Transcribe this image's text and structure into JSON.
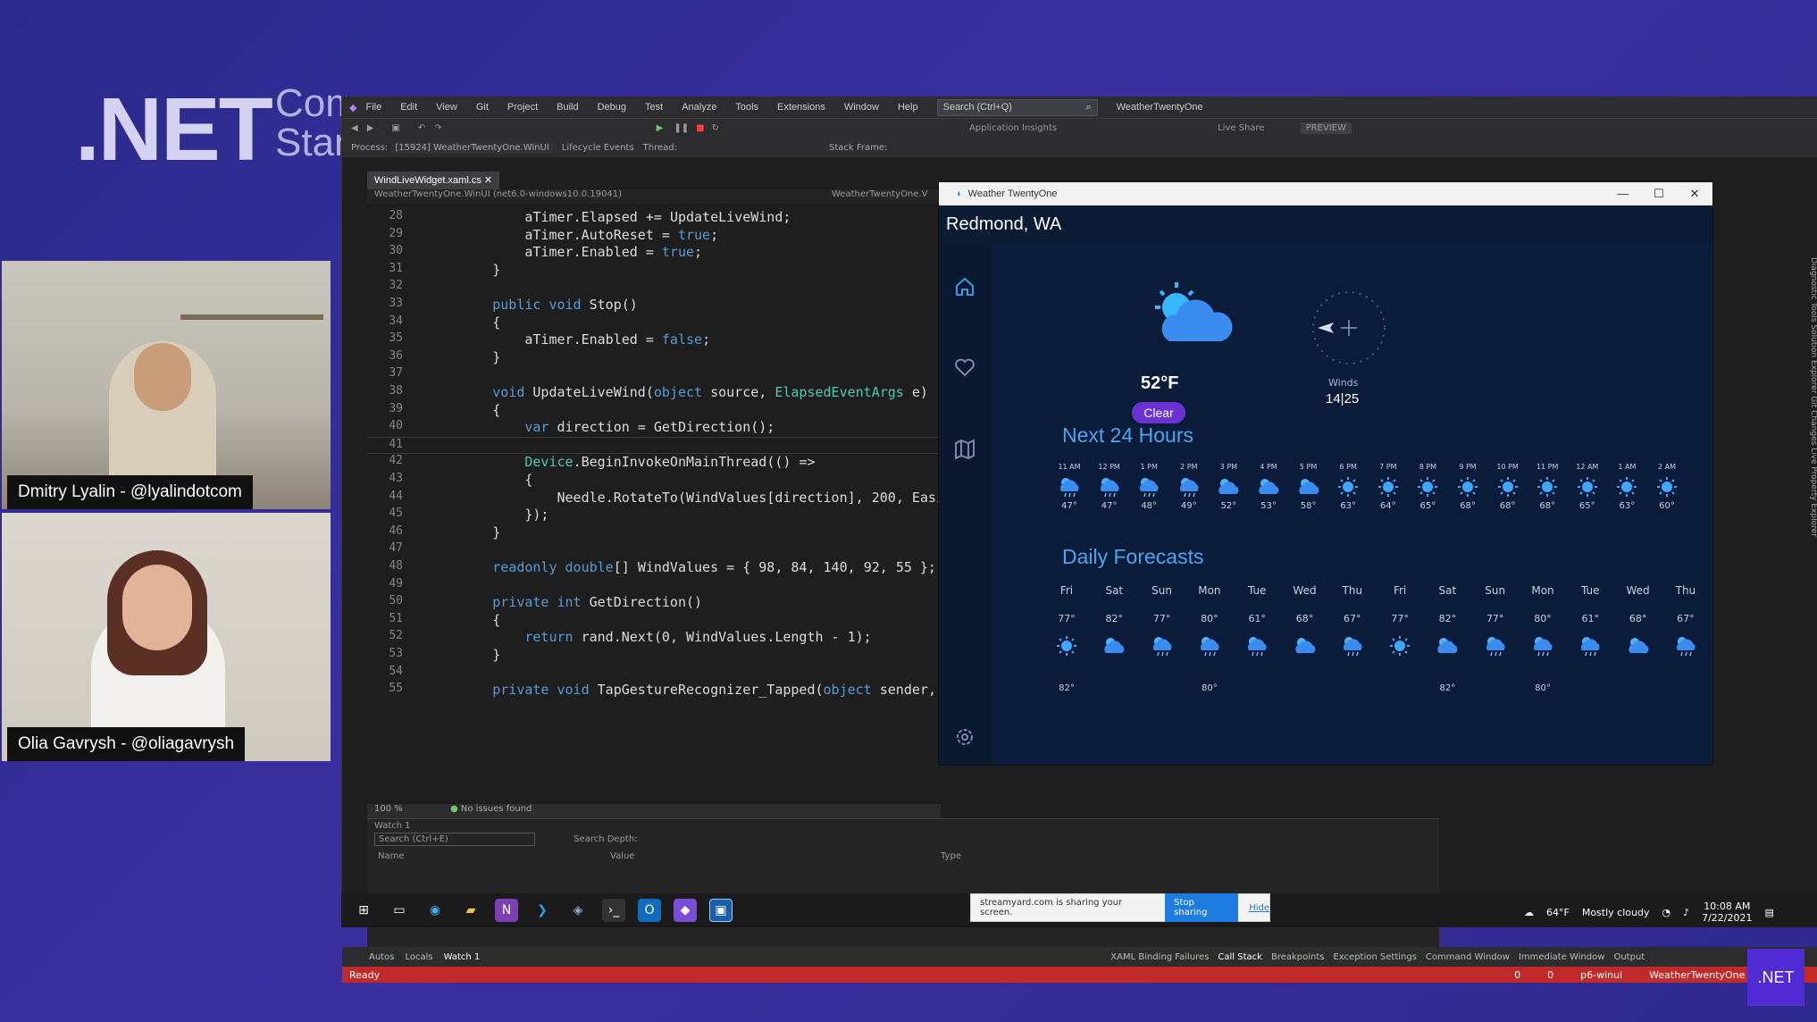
{
  "background": {
    "brand": ".NET",
    "brand_sub_1": "Com",
    "brand_sub_2": "Stan"
  },
  "participants": [
    {
      "name": "Dmitry Lyalin - @lyalindotcom"
    },
    {
      "name": "Olia Gavrysh - @oliagavrysh"
    }
  ],
  "vs": {
    "menu": [
      "File",
      "Edit",
      "View",
      "Git",
      "Project",
      "Build",
      "Debug",
      "Test",
      "Analyze",
      "Tools",
      "Extensions",
      "Window",
      "Help"
    ],
    "search_placeholder": "Search (Ctrl+Q)",
    "solution_title": "WeatherTwentyOne",
    "toolbar_right": [
      "Application Insights",
      "Live Share",
      "PREVIEW"
    ],
    "process_label": "Process:",
    "process_value": "[15924] WeatherTwentyOne.WinUI",
    "lifecycle_label": "Lifecycle Events",
    "thread_label": "Thread:",
    "stack_frame_label": "Stack Frame:",
    "file_tab": "WindLiveWidget.xaml.cs",
    "nav_project": "WeatherTwentyOne.WinUI (net6.0-windows10.0.19041)",
    "nav_class": "WeatherTwentyOne.V",
    "code_lines": [
      {
        "n": "28",
        "code": "            aTimer.Elapsed += UpdateLiveWind;"
      },
      {
        "n": "29",
        "code": "            aTimer.AutoReset = true;"
      },
      {
        "n": "30",
        "code": "            aTimer.Enabled = true;"
      },
      {
        "n": "31",
        "code": "        }"
      },
      {
        "n": "32",
        "code": ""
      },
      {
        "n": "33",
        "code": "        public void Stop()"
      },
      {
        "n": "34",
        "code": "        {"
      },
      {
        "n": "35",
        "code": "            aTimer.Enabled = false;"
      },
      {
        "n": "36",
        "code": "        }"
      },
      {
        "n": "37",
        "code": ""
      },
      {
        "n": "38",
        "code": "        void UpdateLiveWind(object source, ElapsedEventArgs e)"
      },
      {
        "n": "39",
        "code": "        {"
      },
      {
        "n": "40",
        "code": "            var direction = GetDirection();"
      },
      {
        "n": "41",
        "code": ""
      },
      {
        "n": "42",
        "code": "            Device.BeginInvokeOnMainThread(() =>"
      },
      {
        "n": "43",
        "code": "            {"
      },
      {
        "n": "44",
        "code": "                Needle.RotateTo(WindValues[direction], 200, Easi"
      },
      {
        "n": "45",
        "code": "            });"
      },
      {
        "n": "46",
        "code": "        }"
      },
      {
        "n": "47",
        "code": ""
      },
      {
        "n": "48",
        "code": "        readonly double[] WindValues = { 98, 84, 140, 92, 55 };"
      },
      {
        "n": "49",
        "code": ""
      },
      {
        "n": "50",
        "code": "        private int GetDirection()"
      },
      {
        "n": "51",
        "code": "        {"
      },
      {
        "n": "52",
        "code": "            return rand.Next(0, WindValues.Length - 1);"
      },
      {
        "n": "53",
        "code": "        }"
      },
      {
        "n": "54",
        "code": ""
      },
      {
        "n": "55",
        "code": "        private void TapGestureRecognizer_Tapped(object sender,"
      }
    ],
    "zoom": "100 %",
    "issues": "No issues found",
    "watch_title": "Watch 1",
    "watch_search": "Search (Ctrl+E)",
    "watch_depth": "Search Depth:",
    "watch_cols": [
      "Name",
      "Value",
      "Type"
    ],
    "debug_tabs_left": [
      "Autos",
      "Locals",
      "Watch 1"
    ],
    "debug_tabs_right": [
      "XAML Binding Failures",
      "Call Stack",
      "Breakpoints",
      "Exception Settings",
      "Command Window",
      "Immediate Window",
      "Output"
    ],
    "status": "Ready",
    "status_right": [
      "0",
      "0",
      "p6-winui",
      "WeatherTwentyOne"
    ],
    "right_rail": "Diagnostic Tools   Solution Explorer   Git Changes   Live Property Explorer"
  },
  "app": {
    "window_title": "Weather TwentyOne",
    "location": "Redmond, WA",
    "current_temp": "52°F",
    "condition_button": "Clear",
    "winds_label": "Winds",
    "winds_value": "14|25",
    "next24_title": "Next 24 Hours",
    "hours": [
      {
        "t": "11 AM",
        "v": "47°",
        "icon": "cloud-rain"
      },
      {
        "t": "12 PM",
        "v": "47°",
        "icon": "cloud-rain"
      },
      {
        "t": "1 PM",
        "v": "48°",
        "icon": "cloud-rain"
      },
      {
        "t": "2 PM",
        "v": "49°",
        "icon": "cloud-rain"
      },
      {
        "t": "3 PM",
        "v": "52°",
        "icon": "cloud"
      },
      {
        "t": "4 PM",
        "v": "53°",
        "icon": "cloud"
      },
      {
        "t": "5 PM",
        "v": "58°",
        "icon": "cloud"
      },
      {
        "t": "6 PM",
        "v": "63°",
        "icon": "sun"
      },
      {
        "t": "7 PM",
        "v": "64°",
        "icon": "sun"
      },
      {
        "t": "8 PM",
        "v": "65°",
        "icon": "sun"
      },
      {
        "t": "9 PM",
        "v": "68°",
        "icon": "sun"
      },
      {
        "t": "10 PM",
        "v": "68°",
        "icon": "sun"
      },
      {
        "t": "11 PM",
        "v": "68°",
        "icon": "sun"
      },
      {
        "t": "12 AM",
        "v": "65°",
        "icon": "sun"
      },
      {
        "t": "1 AM",
        "v": "63°",
        "icon": "sun"
      },
      {
        "t": "2 AM",
        "v": "60°",
        "icon": "sun"
      }
    ],
    "daily_title": "Daily Forecasts",
    "days": [
      {
        "d": "Fri",
        "v": "77°",
        "icon": "sun",
        "lo": "82°"
      },
      {
        "d": "Sat",
        "v": "82°",
        "icon": "cloud",
        "lo": ""
      },
      {
        "d": "Sun",
        "v": "77°",
        "icon": "cloud-rain",
        "lo": ""
      },
      {
        "d": "Mon",
        "v": "80°",
        "icon": "cloud-rain",
        "lo": "80°"
      },
      {
        "d": "Tue",
        "v": "61°",
        "icon": "cloud-rain",
        "lo": ""
      },
      {
        "d": "Wed",
        "v": "68°",
        "icon": "cloud",
        "lo": ""
      },
      {
        "d": "Thu",
        "v": "67°",
        "icon": "cloud-rain",
        "lo": ""
      },
      {
        "d": "Fri",
        "v": "77°",
        "icon": "sun",
        "lo": ""
      },
      {
        "d": "Sat",
        "v": "82°",
        "icon": "cloud",
        "lo": "82°"
      },
      {
        "d": "Sun",
        "v": "77°",
        "icon": "cloud-rain",
        "lo": ""
      },
      {
        "d": "Mon",
        "v": "80°",
        "icon": "cloud-rain",
        "lo": "80°"
      },
      {
        "d": "Tue",
        "v": "61°",
        "icon": "cloud-rain",
        "lo": ""
      },
      {
        "d": "Wed",
        "v": "68°",
        "icon": "cloud",
        "lo": ""
      },
      {
        "d": "Thu",
        "v": "67°",
        "icon": "cloud-rain",
        "lo": ""
      }
    ]
  },
  "share_bar": {
    "text": "streamyard.com is sharing your screen.",
    "stop": "Stop sharing",
    "hide": "Hide"
  },
  "tray": {
    "temp": "64°F",
    "condition": "Mostly cloudy",
    "time": "10:08 AM",
    "date": "7/22/2021"
  },
  "badge": ".NET",
  "colors": {
    "accent": "#512bd4",
    "clear_button": "#6a32d2",
    "section_title": "#4aa6f0",
    "status_bar": "#c22a2a"
  }
}
